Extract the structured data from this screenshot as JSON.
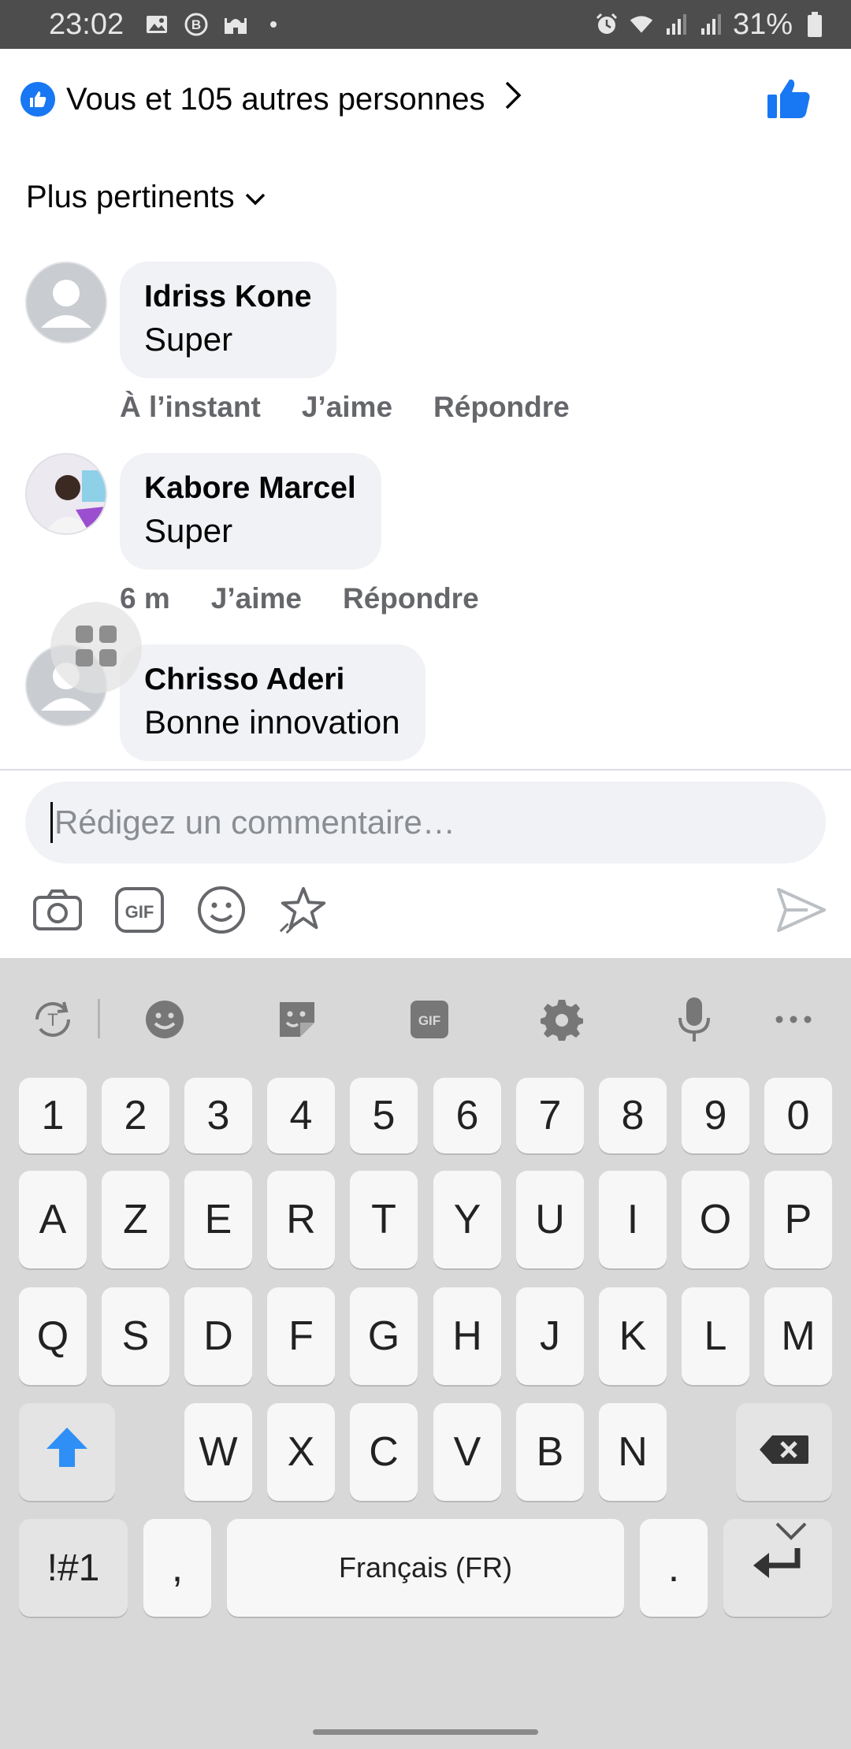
{
  "status_bar": {
    "time": "23:02",
    "battery": "31%",
    "icons_left": [
      "image-icon",
      "b-circle-icon",
      "mosque-icon"
    ],
    "icons_right": [
      "alarm-icon",
      "wifi-icon",
      "signal-icon",
      "signal-icon",
      "battery-icon"
    ]
  },
  "reactions": {
    "summary": "Vous et 105 autres personnes"
  },
  "sort": {
    "label": "Plus pertinents"
  },
  "comments": [
    {
      "author": "Idriss Kone",
      "text": "Super",
      "time": "À l’instant",
      "like": "J’aime",
      "reply": "Répondre"
    },
    {
      "author": "Kabore Marcel",
      "text": "Super",
      "time": "6 m",
      "like": "J’aime",
      "reply": "Répondre"
    },
    {
      "author": "Chrisso Aderi",
      "text": "Bonne innovation"
    }
  ],
  "composer": {
    "placeholder": "Rédigez un commentaire…"
  },
  "composer_tools": [
    "camera-icon",
    "gif-icon",
    "emoji-icon",
    "sticker-icon",
    "send-icon"
  ],
  "keyboard": {
    "toolbar": [
      "text-translate-icon",
      "emoji-icon",
      "sticker-icon",
      "gif-icon",
      "settings-icon",
      "microphone-icon",
      "more-icon"
    ],
    "row1": [
      "1",
      "2",
      "3",
      "4",
      "5",
      "6",
      "7",
      "8",
      "9",
      "0"
    ],
    "row2": [
      "A",
      "Z",
      "E",
      "R",
      "T",
      "Y",
      "U",
      "I",
      "O",
      "P"
    ],
    "row3": [
      "Q",
      "S",
      "D",
      "F",
      "G",
      "H",
      "J",
      "K",
      "L",
      "M"
    ],
    "row4": [
      "W",
      "X",
      "C",
      "V",
      "B",
      "N"
    ],
    "sym_key": "!#1",
    "comma": ",",
    "space": "Français (FR)",
    "period": ".",
    "gif_label": "GIF"
  },
  "colors": {
    "facebook_blue": "#1877f2",
    "bubble": "#f0f2f5",
    "meta_gray": "#65676b",
    "keyboard_bg": "#d8d8d8",
    "shift_blue": "#2f8ff7"
  }
}
